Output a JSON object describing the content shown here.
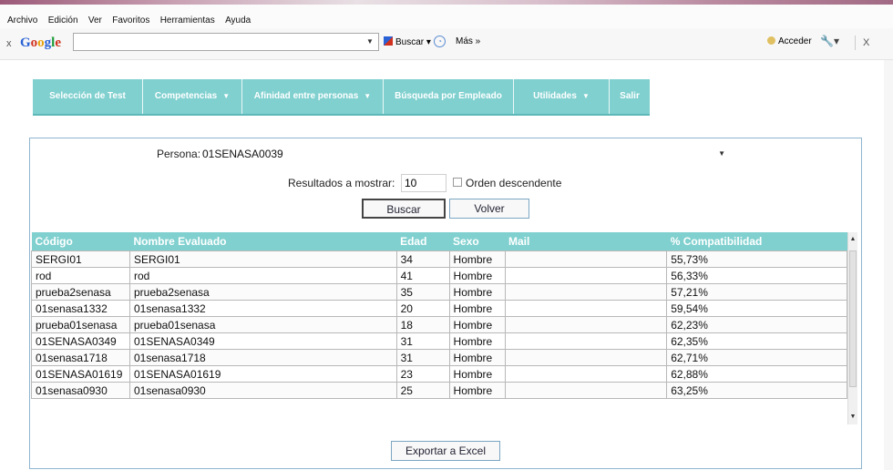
{
  "browser": {
    "menu": [
      "Archivo",
      "Edición",
      "Ver",
      "Favoritos",
      "Herramientas",
      "Ayuda"
    ],
    "toolbar": {
      "close_x": "x",
      "google_logo": "Google",
      "buscar": "Buscar",
      "mas": "Más »",
      "acceder": "Acceder",
      "close_right": "X"
    }
  },
  "nav": {
    "items": [
      {
        "label": "Selección de Test",
        "caret": ""
      },
      {
        "label": "Competencias",
        "caret": "▼"
      },
      {
        "label": "Afinidad entre personas",
        "caret": "▼"
      },
      {
        "label": "Búsqueda por Empleado",
        "caret": ""
      },
      {
        "label": "Utilidades",
        "caret": "▼"
      },
      {
        "label": "Salir",
        "caret": ""
      }
    ]
  },
  "form": {
    "persona_label": "Persona:",
    "persona_value": "01SENASA0039",
    "resultados_label": "Resultados a mostrar:",
    "resultados_value": "10",
    "orden_label": "Orden descendente",
    "buscar_label": "Buscar",
    "volver_label": "Volver",
    "excel_label": "Exportar a Excel"
  },
  "table": {
    "headers": [
      "Código",
      "Nombre Evaluado",
      "Edad",
      "Sexo",
      "Mail",
      "% Compatibilidad"
    ],
    "rows": [
      [
        "SERGI01",
        "SERGI01",
        "34",
        "Hombre",
        "",
        "55,73%"
      ],
      [
        "rod",
        "rod",
        "41",
        "Hombre",
        "",
        "56,33%"
      ],
      [
        "prueba2senasa",
        "prueba2senasa",
        "35",
        "Hombre",
        "",
        "57,21%"
      ],
      [
        "01senasa1332",
        "01senasa1332",
        "20",
        "Hombre",
        "",
        "59,54%"
      ],
      [
        "prueba01senasa",
        "prueba01senasa",
        "18",
        "Hombre",
        "",
        "62,23%"
      ],
      [
        "01SENASA0349",
        "01SENASA0349",
        "31",
        "Hombre",
        "",
        "62,35%"
      ],
      [
        "01senasa1718",
        "01senasa1718",
        "31",
        "Hombre",
        "",
        "62,71%"
      ],
      [
        "01SENASA01619",
        "01SENASA01619",
        "23",
        "Hombre",
        "",
        "62,88%"
      ],
      [
        "01senasa0930",
        "01senasa0930",
        "25",
        "Hombre",
        "",
        "63,25%"
      ]
    ]
  },
  "colors": {
    "accent": "#7fd0cf",
    "panel_border": "#8fb5d0"
  }
}
